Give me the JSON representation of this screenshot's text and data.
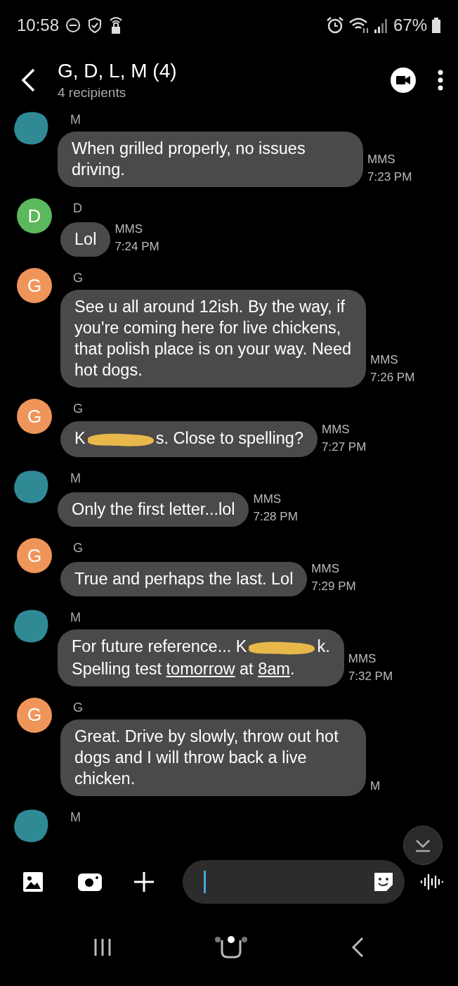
{
  "status_bar": {
    "time": "10:58",
    "battery": "67%"
  },
  "header": {
    "title": "G, D, L, M (4)",
    "subtitle": "4 recipients"
  },
  "messages": [
    {
      "sender": "M",
      "avatar": {
        "kind": "redacted"
      },
      "segments": [
        {
          "kind": "text",
          "text": "When grilled properly, no issues driving."
        }
      ],
      "type": "MMS",
      "time": "7:23 PM"
    },
    {
      "sender": "D",
      "avatar": {
        "kind": "letter",
        "letter": "D",
        "color": "#5cb85c"
      },
      "segments": [
        {
          "kind": "text",
          "text": "Lol"
        }
      ],
      "type": "MMS",
      "time": "7:24 PM"
    },
    {
      "sender": "G",
      "avatar": {
        "kind": "letter",
        "letter": "G",
        "color": "#f0955a"
      },
      "segments": [
        {
          "kind": "text",
          "text": "See u all around 12ish. By the way, if you're coming here for live chickens, that polish place is on your way. Need hot dogs."
        }
      ],
      "type": "MMS",
      "time": "7:26 PM"
    },
    {
      "sender": "G",
      "avatar": {
        "kind": "letter",
        "letter": "G",
        "color": "#f0955a"
      },
      "segments": [
        {
          "kind": "text",
          "text": "K"
        },
        {
          "kind": "redaction"
        },
        {
          "kind": "text",
          "text": "s. Close to spelling?"
        }
      ],
      "type": "MMS",
      "time": "7:27 PM"
    },
    {
      "sender": "M",
      "avatar": {
        "kind": "redacted"
      },
      "segments": [
        {
          "kind": "text",
          "text": "Only the first letter...lol"
        }
      ],
      "type": "MMS",
      "time": "7:28 PM"
    },
    {
      "sender": "G",
      "avatar": {
        "kind": "letter",
        "letter": "G",
        "color": "#f0955a"
      },
      "segments": [
        {
          "kind": "text",
          "text": "True and perhaps the last. Lol"
        }
      ],
      "type": "MMS",
      "time": "7:29 PM"
    },
    {
      "sender": "M",
      "avatar": {
        "kind": "redacted"
      },
      "segments": [
        {
          "kind": "text",
          "text": "For future reference... K"
        },
        {
          "kind": "redaction"
        },
        {
          "kind": "text",
          "text": "k."
        },
        {
          "kind": "break"
        },
        {
          "kind": "text",
          "text": "Spelling test "
        },
        {
          "kind": "link",
          "text": "tomorrow"
        },
        {
          "kind": "text",
          "text": " at "
        },
        {
          "kind": "link",
          "text": "8am"
        },
        {
          "kind": "text",
          "text": "."
        }
      ],
      "type": "MMS",
      "time": "7:32 PM"
    },
    {
      "sender": "G",
      "avatar": {
        "kind": "letter",
        "letter": "G",
        "color": "#f0955a"
      },
      "segments": [
        {
          "kind": "text",
          "text": "Great. Drive by slowly, throw out hot dogs and I will throw back a live chicken."
        }
      ],
      "type": "M"
    },
    {
      "sender": "M",
      "avatar": {
        "kind": "redacted"
      }
    }
  ]
}
